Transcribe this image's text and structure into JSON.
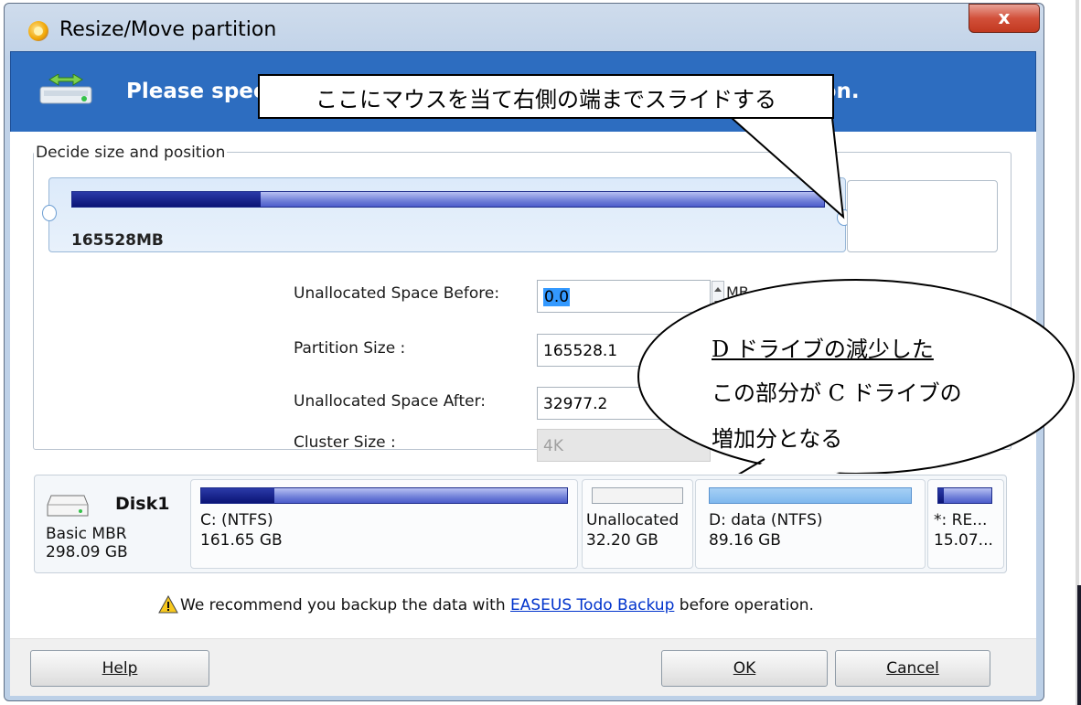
{
  "window": {
    "title": "Resize/Move partition",
    "close_label": "x",
    "banner_text": "Please specify the size and the location for the new partition."
  },
  "decide": {
    "legend": "Decide size and position",
    "slider_label": "165528MB",
    "slider_used_fraction": 0.25
  },
  "fields": {
    "before_label": "Unallocated Space Before:",
    "before_value": "0.0",
    "before_unit": "MB",
    "size_label": "Partition Size :",
    "size_value": "165528.1",
    "after_label": "Unallocated Space After:",
    "after_value": "32977.2",
    "cluster_label": "Cluster Size :",
    "cluster_value": "4K"
  },
  "disk": {
    "name": "Disk1",
    "type": "Basic MBR",
    "size": "298.09 GB",
    "partitions": [
      {
        "name": "C: (NTFS)",
        "size": "161.65 GB",
        "used_fraction": 0.2
      },
      {
        "name": "Unallocated",
        "size": "32.20 GB",
        "used_fraction": 0
      },
      {
        "name": "D: data (NTFS)",
        "size": "89.16 GB",
        "used_fraction": 0
      },
      {
        "name": "*: RE...",
        "size": "15.07...",
        "used_fraction": 0.1
      }
    ]
  },
  "warning": {
    "before": "We recommend you backup the data with ",
    "link": "EASEUS Todo Backup",
    "after": " before operation."
  },
  "buttons": {
    "help": "Help",
    "ok": "OK",
    "cancel": "Cancel"
  },
  "annotations": {
    "top_callout": "ここにマウスを当て右側の端までスライドする",
    "bubble_line1": "D ドライブの減少した",
    "bubble_line2": "この部分が C ドライブの",
    "bubble_line3": "増加分となる"
  }
}
